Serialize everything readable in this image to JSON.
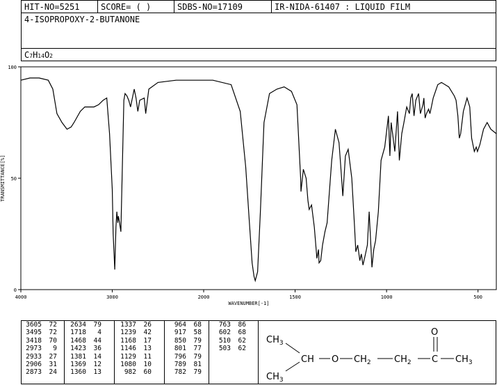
{
  "header": {
    "hit_no": "HIT-NO=5251",
    "score": "SCORE=  (   )",
    "sdbs_no": "SDBS-NO=17109",
    "ir_info": "IR-NIDA-61407 : LIQUID FILM"
  },
  "compound": {
    "name": "4-ISOPROPOXY-2-BUTANONE",
    "formula_main": "C",
    "formula_sub1": "7",
    "formula_h": "H",
    "formula_sub2": "14",
    "formula_o": "O",
    "formula_sub3": "2"
  },
  "chart_data": {
    "type": "line",
    "xlabel": "WAVENUMBER[-1]",
    "ylabel": "TRANSMITTANCE[%]",
    "xlim": [
      4000,
      400
    ],
    "ylim": [
      0,
      100
    ],
    "x_ticks": [
      "4000",
      "3000",
      "2000",
      "1500",
      "1000",
      "500"
    ],
    "y_ticks": [
      "100",
      "50",
      "0"
    ],
    "series": [
      {
        "x": [
          4000,
          3900,
          3800,
          3700,
          3650,
          3605,
          3550,
          3495,
          3450,
          3418,
          3350,
          3300,
          3200,
          3150,
          3100,
          3060,
          3030,
          3000,
          2990,
          2973,
          2960,
          2950,
          2940,
          2933,
          2920,
          2906,
          2890,
          2873,
          2860,
          2840,
          2820,
          2800,
          2760,
          2740,
          2720,
          2700,
          2650,
          2634,
          2600,
          2500,
          2300,
          2100,
          1950,
          1850,
          1800,
          1770,
          1750,
          1735,
          1725,
          1718,
          1705,
          1690,
          1670,
          1640,
          1600,
          1560,
          1520,
          1490,
          1470,
          1468,
          1455,
          1440,
          1430,
          1423,
          1410,
          1395,
          1381,
          1372,
          1369,
          1360,
          1350,
          1337,
          1325,
          1300,
          1280,
          1260,
          1250,
          1239,
          1225,
          1210,
          1190,
          1175,
          1168,
          1158,
          1146,
          1138,
          1129,
          1118,
          1105,
          1095,
          1080,
          1070,
          1060,
          1045,
          1030,
          1010,
          990,
          982,
          975,
          964,
          955,
          940,
          930,
          917,
          905,
          890,
          875,
          868,
          860,
          850,
          840,
          825,
          815,
          801,
          796,
          789,
          782,
          770,
          763,
          755,
          745,
          720,
          700,
          680,
          660,
          645,
          630,
          620,
          610,
          602,
          595,
          580,
          560,
          545,
          535,
          520,
          510,
          503,
          490,
          470,
          450,
          430,
          400
        ],
        "y": [
          94,
          95,
          95,
          94,
          90,
          79,
          75,
          72,
          73,
          75,
          80,
          82,
          82,
          83,
          85,
          86,
          70,
          45,
          25,
          9,
          28,
          35,
          30,
          33,
          30,
          26,
          55,
          85,
          88,
          87,
          85,
          82,
          90,
          86,
          80,
          85,
          86,
          79,
          90,
          93,
          94,
          94,
          94,
          92,
          80,
          55,
          30,
          12,
          6,
          4,
          8,
          35,
          75,
          88,
          90,
          91,
          89,
          83,
          50,
          44,
          54,
          50,
          40,
          36,
          38,
          28,
          14,
          18,
          12,
          13,
          20,
          26,
          30,
          58,
          72,
          66,
          55,
          42,
          60,
          63,
          50,
          28,
          17,
          20,
          13,
          16,
          11,
          15,
          20,
          35,
          10,
          18,
          22,
          35,
          58,
          64,
          78,
          60,
          75,
          68,
          62,
          80,
          58,
          70,
          75,
          82,
          79,
          86,
          88,
          78,
          85,
          88,
          79,
          83,
          86,
          77,
          79,
          81,
          79,
          82,
          86,
          92,
          93,
          92,
          91,
          89,
          87,
          85,
          78,
          68,
          70,
          80,
          86,
          82,
          68,
          62,
          64,
          62,
          65,
          72,
          75,
          72,
          70
        ]
      }
    ]
  },
  "peaks": {
    "columns": [
      [
        [
          "3605",
          "72"
        ],
        [
          "3495",
          "72"
        ],
        [
          "3418",
          "70"
        ],
        [
          "2973",
          "9"
        ],
        [
          "2933",
          "27"
        ],
        [
          "2906",
          "31"
        ],
        [
          "2873",
          "24"
        ]
      ],
      [
        [
          "2634",
          "79"
        ],
        [
          "1718",
          "4"
        ],
        [
          "1468",
          "44"
        ],
        [
          "1423",
          "36"
        ],
        [
          "1381",
          "14"
        ],
        [
          "1369",
          "12"
        ],
        [
          "1360",
          "13"
        ]
      ],
      [
        [
          "1337",
          "26"
        ],
        [
          "1239",
          "42"
        ],
        [
          "1168",
          "17"
        ],
        [
          "1146",
          "13"
        ],
        [
          "1129",
          "11"
        ],
        [
          "1080",
          "10"
        ],
        [
          "982",
          "60"
        ]
      ],
      [
        [
          "964",
          "68"
        ],
        [
          "917",
          "58"
        ],
        [
          "850",
          "79"
        ],
        [
          "801",
          "77"
        ],
        [
          "796",
          "79"
        ],
        [
          "789",
          "81"
        ],
        [
          "782",
          "79"
        ]
      ],
      [
        [
          "763",
          "86"
        ],
        [
          "602",
          "68"
        ],
        [
          "510",
          "62"
        ],
        [
          "503",
          "62"
        ]
      ]
    ]
  },
  "structure": {
    "ch3_top": "CH",
    "ch3_top_sub": "3",
    "ch3_bottom": "CH",
    "ch3_bottom_sub": "3",
    "ch": "CH",
    "o": "O",
    "ch2_a": "CH",
    "ch2_a_sub": "2",
    "ch2_b": "CH",
    "ch2_b_sub": "2",
    "c": "C",
    "o_top": "O",
    "ch3_end": "CH",
    "ch3_end_sub": "3"
  }
}
